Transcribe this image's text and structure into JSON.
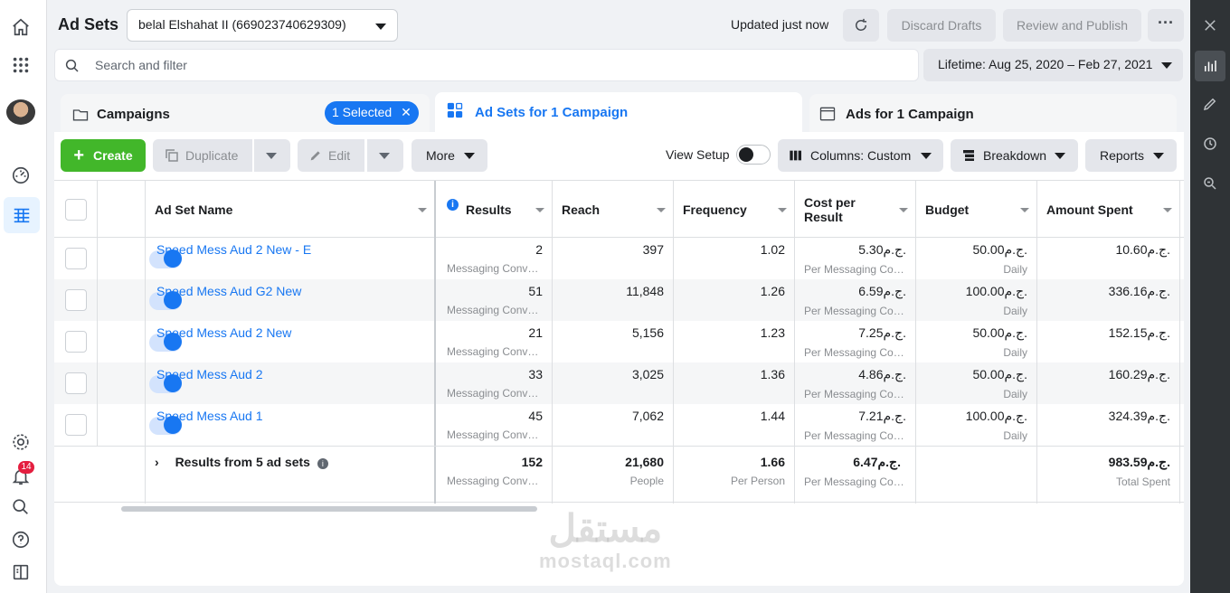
{
  "header": {
    "title": "Ad Sets",
    "account": "belal Elshahat II (669023740629309)",
    "status": "Updated just now",
    "discard_label": "Discard Drafts",
    "review_label": "Review and Publish",
    "more_label": "···"
  },
  "search": {
    "placeholder": "Search and filter"
  },
  "date_range": "Lifetime: Aug 25, 2020 – Feb 27, 2021",
  "tabs": {
    "campaigns": "Campaigns",
    "selected": "1 Selected",
    "adsets": "Ad Sets for 1 Campaign",
    "ads": "Ads for 1 Campaign"
  },
  "toolbar": {
    "create": "Create",
    "duplicate": "Duplicate",
    "edit": "Edit",
    "more": "More",
    "view_setup": "View Setup",
    "columns": "Columns: Custom",
    "breakdown": "Breakdown",
    "reports": "Reports"
  },
  "columns": {
    "name": "Ad Set Name",
    "results": "Results",
    "reach": "Reach",
    "frequency": "Frequency",
    "cpr": "Cost per Result",
    "budget": "Budget",
    "spent": "Amount Spent"
  },
  "rows": [
    {
      "name": "Speed Mess Aud 2 New - E",
      "results": "2",
      "results_sub": "Messaging Conversations Started",
      "reach": "397",
      "frequency": "1.02",
      "cpr": "5.30ج.م.",
      "cpr_sub": "Per Messaging Conversation Started",
      "budget": "50.00ج.م.",
      "budget_sub": "Daily",
      "spent": "10.60ج.م."
    },
    {
      "name": "Speed Mess Aud G2 New",
      "results": "51",
      "results_sub": "Messaging Conversations Started",
      "reach": "11,848",
      "frequency": "1.26",
      "cpr": "6.59ج.م.",
      "cpr_sub": "Per Messaging Conversation Started",
      "budget": "100.00ج.م.",
      "budget_sub": "Daily",
      "spent": "336.16ج.م."
    },
    {
      "name": "Speed Mess Aud 2 New",
      "results": "21",
      "results_sub": "Messaging Conversations Started",
      "reach": "5,156",
      "frequency": "1.23",
      "cpr": "7.25ج.م.",
      "cpr_sub": "Per Messaging Conversation Started",
      "budget": "50.00ج.م.",
      "budget_sub": "Daily",
      "spent": "152.15ج.م."
    },
    {
      "name": "Speed Mess Aud 2",
      "results": "33",
      "results_sub": "Messaging Conversations Started",
      "reach": "3,025",
      "frequency": "1.36",
      "cpr": "4.86ج.م.",
      "cpr_sub": "Per Messaging Conversation Started",
      "budget": "50.00ج.م.",
      "budget_sub": "Daily",
      "spent": "160.29ج.م."
    },
    {
      "name": "Speed Mess Aud 1",
      "results": "45",
      "results_sub": "Messaging Conversations Started",
      "reach": "7,062",
      "frequency": "1.44",
      "cpr": "7.21ج.م.",
      "cpr_sub": "Per Messaging Conversation Started",
      "budget": "100.00ج.م.",
      "budget_sub": "Daily",
      "spent": "324.39ج.م."
    }
  ],
  "summary": {
    "label": "Results from 5 ad sets",
    "results": "152",
    "results_sub": "Messaging Conversations Started",
    "reach": "21,680",
    "reach_sub": "People",
    "frequency": "1.66",
    "frequency_sub": "Per Person",
    "cpr": "6.47ج.م.",
    "cpr_sub": "Per Messaging Conversation Started",
    "spent": "983.59ج.م.",
    "spent_sub": "Total Spent"
  },
  "notifications": {
    "count": "14"
  },
  "watermark": {
    "arabic": "مستقل",
    "latin": "mostaql.com"
  },
  "colors": {
    "accent": "#1877f2",
    "create": "#42b72a",
    "rail": "#2f3336",
    "badge": "#e41e3f"
  },
  "icons": [
    "home-icon",
    "apps-grid-icon",
    "dashboard-icon",
    "table-icon",
    "settings-icon",
    "bell-icon",
    "search-icon",
    "help-icon",
    "sidebar-toggle-icon",
    "close-icon",
    "bar-chart-icon",
    "pencil-icon",
    "clock-icon",
    "zoom-icon",
    "refresh-icon",
    "folder-icon",
    "grid-icon",
    "ad-icon",
    "duplicate-icon",
    "columns-icon",
    "breakdown-icon",
    "info-icon"
  ]
}
